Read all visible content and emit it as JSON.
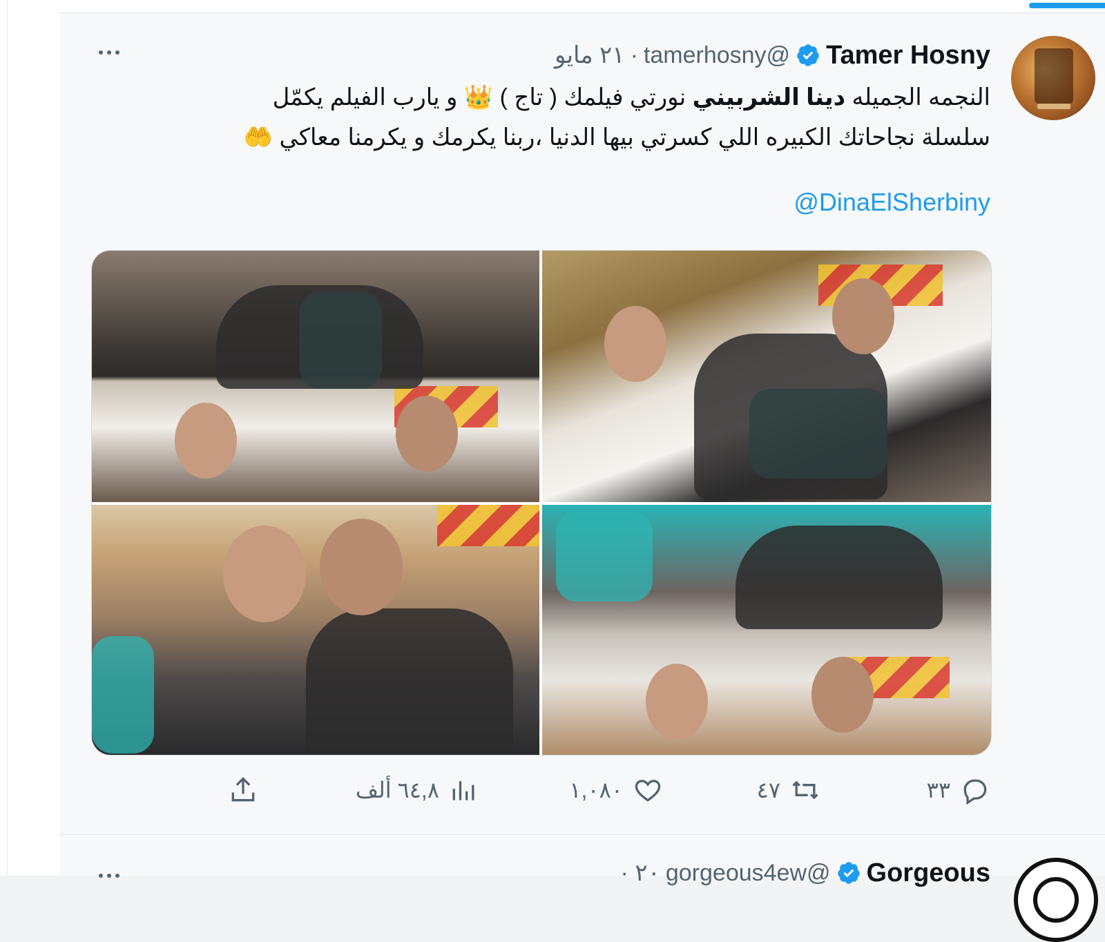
{
  "tweet": {
    "display_name": "Tamer Hosny",
    "handle": "@tamerhosny",
    "separator": "·",
    "date": "٢١ مايو",
    "text_line1_part1": "النجمه الجميله",
    "text_line1_bold": "دينا الشربيني",
    "text_line1_part2": "نورتي فيلمك  ( تاج ) 👑 و يارب الفيلم يكمّل",
    "text_line2": "سلسلة نجاحاتك الكبيره اللي كسرتي بيها الدنيا ،ربنا يكرمك و يكرمنا معاكي 🤲",
    "mention": "@DinaElSherbiny",
    "actions": {
      "replies": "٣٣",
      "retweets": "٤٧",
      "likes": "١,٠٨٠",
      "views": "٦٤,٨ ألف"
    }
  },
  "next_tweet": {
    "display_name": "Gorgeous",
    "handle": "@gorgeous4ew",
    "date": "٢٠ ·"
  },
  "colors": {
    "accent": "#1d9bf0",
    "secondary_text": "#536471",
    "primary_text": "#0f1419"
  },
  "icons": {
    "verified": "verified-badge-icon",
    "more": "more-dots-icon",
    "reply": "reply-icon",
    "retweet": "retweet-icon",
    "like": "heart-icon",
    "views": "views-chart-icon",
    "share": "share-icon"
  }
}
